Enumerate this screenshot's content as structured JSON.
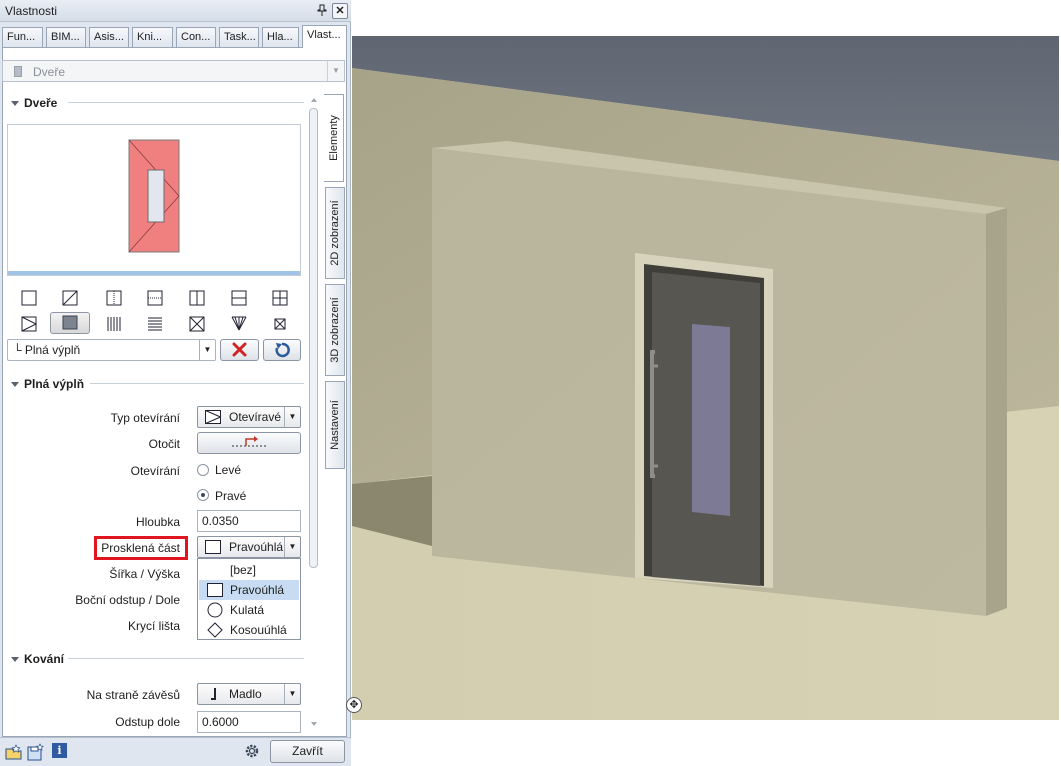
{
  "window": {
    "title": "Vlastnosti",
    "pin_glyph": "↕",
    "close_glyph": "✖"
  },
  "tabs": [
    {
      "label": "Fun..."
    },
    {
      "label": "BIM..."
    },
    {
      "label": "Asis..."
    },
    {
      "label": "Kni..."
    },
    {
      "label": "Con..."
    },
    {
      "label": "Task..."
    },
    {
      "label": "Hla..."
    },
    {
      "label": "Vlast...",
      "active": true
    }
  ],
  "element_selector": {
    "value": "Dveře"
  },
  "sections": {
    "dvere": {
      "title": "Dveře"
    },
    "plna_vypln": {
      "title": "Plná výplň"
    },
    "kovani": {
      "title": "Kování"
    }
  },
  "fill_selector": {
    "value": "└ Plná výplň"
  },
  "properties": {
    "typ_otevirani": {
      "label": "Typ otevírání",
      "value": "Otevíravé"
    },
    "otocit": {
      "label": "Otočit"
    },
    "otevirani": {
      "label": "Otevírání",
      "options": [
        {
          "label": "Levé",
          "checked": false
        },
        {
          "label": "Pravé",
          "checked": true
        }
      ]
    },
    "hloubka": {
      "label": "Hloubka",
      "value": "0.0350"
    },
    "prosklena_cast": {
      "label": "Prosklená část",
      "value": "Pravoúhlá"
    },
    "sirka_vyska": {
      "label": "Šířka / Výška"
    },
    "bocni_odstup": {
      "label": "Boční odstup / Dole"
    },
    "kryci_lista": {
      "label": "Krycí lišta"
    },
    "na_strane_zavesu": {
      "label": "Na straně závěsů",
      "value": "Madlo"
    },
    "odstup_dole": {
      "label": "Odstup dole",
      "value": "0.6000"
    }
  },
  "glass_dropdown": {
    "items": [
      {
        "label": "[bez]",
        "icon": "none"
      },
      {
        "label": "Pravoúhlá",
        "icon": "rectangle-icon",
        "highlighted": true
      },
      {
        "label": "Kulatá",
        "icon": "circle-icon"
      },
      {
        "label": "Kosouúhlá",
        "icon": "diamond-icon"
      }
    ]
  },
  "side_tabs": [
    {
      "label": "Elementy",
      "active": true
    },
    {
      "label": "2D zobrazení"
    },
    {
      "label": "3D zobrazení"
    },
    {
      "label": "Nastavení"
    }
  ],
  "bottom": {
    "close_label": "Zavřít"
  },
  "colors": {
    "highlight_box": "#e0151f",
    "door_preview_fill": "#f08080",
    "selection": "#c7dcf2"
  }
}
